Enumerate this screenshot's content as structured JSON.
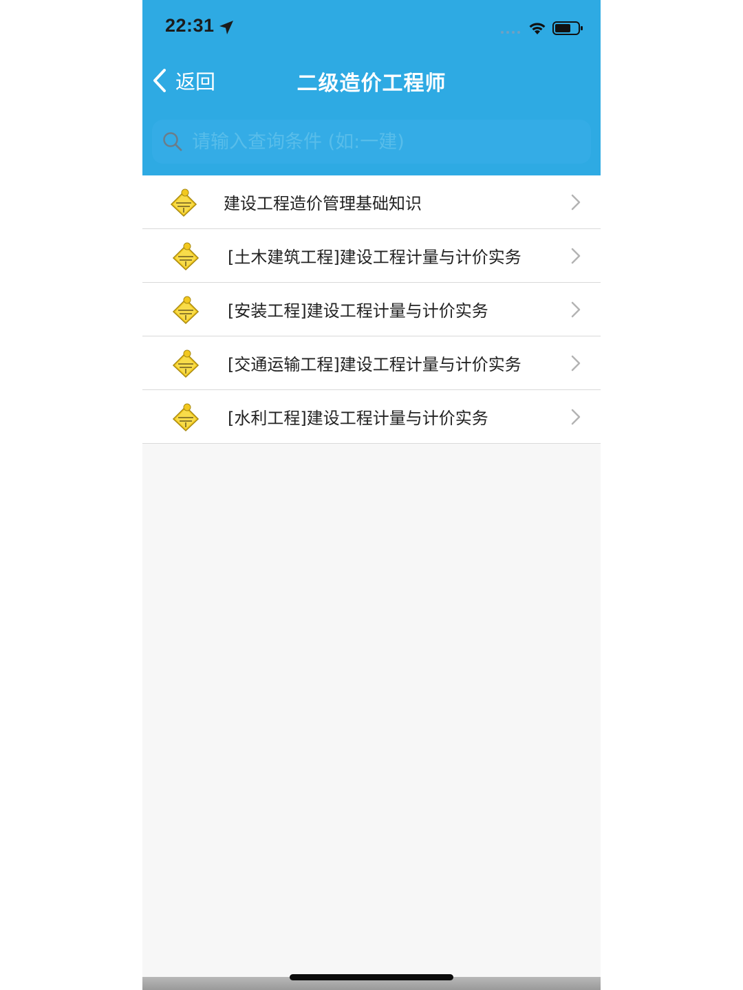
{
  "status_bar": {
    "time": "22:31",
    "location_icon": "location-arrow-icon",
    "signal_icon": "cellular-signal-icon",
    "wifi_icon": "wifi-icon",
    "battery_icon": "battery-icon"
  },
  "nav": {
    "back_label": "返回",
    "back_icon": "chevron-left-icon",
    "title": "二级造价工程师"
  },
  "search": {
    "placeholder": "请输入查询条件 (如:一建)",
    "value": "",
    "icon": "search-icon"
  },
  "list": {
    "items": [
      {
        "label": "建设工程造价管理基础知识",
        "icon": "construction-sign-icon"
      },
      {
        "label": "[土木建筑工程]建设工程计量与计价实务",
        "icon": "construction-sign-icon"
      },
      {
        "label": "[安装工程]建设工程计量与计价实务",
        "icon": "construction-sign-icon"
      },
      {
        "label": "[交通运输工程]建设工程计量与计价实务",
        "icon": "construction-sign-icon"
      },
      {
        "label": "[水利工程]建设工程计量与计价实务",
        "icon": "construction-sign-icon"
      }
    ],
    "chevron_icon": "chevron-right-icon"
  },
  "colors": {
    "header_background": "#2eaae3",
    "list_background": "#ffffff",
    "page_background": "#f7f7f7",
    "icon_yellow": "#f2c81f"
  }
}
